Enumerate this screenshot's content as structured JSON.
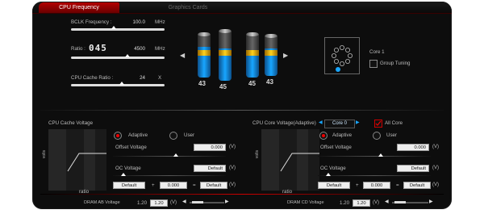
{
  "tabs": [
    {
      "label": "CPU Frequency"
    },
    {
      "label": "Graphics Cards"
    }
  ],
  "top": {
    "bclk": {
      "label": "BCLK Frequency :",
      "value": "100.0",
      "unit": "MHz",
      "level": 0.45
    },
    "ratio": {
      "label": "Ratio :",
      "digits": "045",
      "value": "4500",
      "unit": "MHz",
      "level": 0.6
    },
    "cache_ratio": {
      "label": "CPU Cache Ratio :",
      "value": "24",
      "unit": "X",
      "level": 0.55
    },
    "cylinders": [
      {
        "number": "43",
        "fill": 0.7
      },
      {
        "number": "45",
        "fill": 0.65
      },
      {
        "number": "45",
        "fill": 0.6
      },
      {
        "number": "43",
        "fill": 0.65
      }
    ],
    "core": {
      "label": "Core 1",
      "group_tuning": "Group Tuning"
    }
  },
  "cache_voltage": {
    "title": "CPU Cache Voltage",
    "adaptive": "Adaptive",
    "user": "User",
    "offset_label": "Offset Voltage",
    "offset_value": "0.000",
    "unit": "(V)",
    "oc_label": "OC Voltage",
    "oc_value": "Default",
    "formula": [
      "Default",
      "+",
      "0.000",
      "=",
      "Default"
    ],
    "graph_x": "ratio",
    "graph_y": "volts"
  },
  "core_voltage": {
    "title": "CPU Core Voltage(Adaptive)",
    "core_select": "Core 0",
    "all_core": "All Core",
    "adaptive": "Adaptive",
    "user": "User",
    "offset_label": "Offset Voltage",
    "offset_value": "0.000",
    "unit": "(V)",
    "oc_label": "OC Voltage",
    "oc_value": "Default",
    "formula": [
      "Default",
      "+",
      "0.000",
      "=",
      "Default"
    ],
    "graph_x": "ratio",
    "graph_y": "volts"
  },
  "dram": {
    "ab": {
      "label": "DRAM AB Voltage",
      "value": "1.20",
      "input": "1.20",
      "unit": "(V)"
    },
    "cd": {
      "label": "DRAM CD Voltage",
      "value": "1.20",
      "input": "1.20",
      "unit": "(V)"
    }
  },
  "colors": {
    "accent": "#c00000",
    "highlight": "#18a6ff"
  }
}
